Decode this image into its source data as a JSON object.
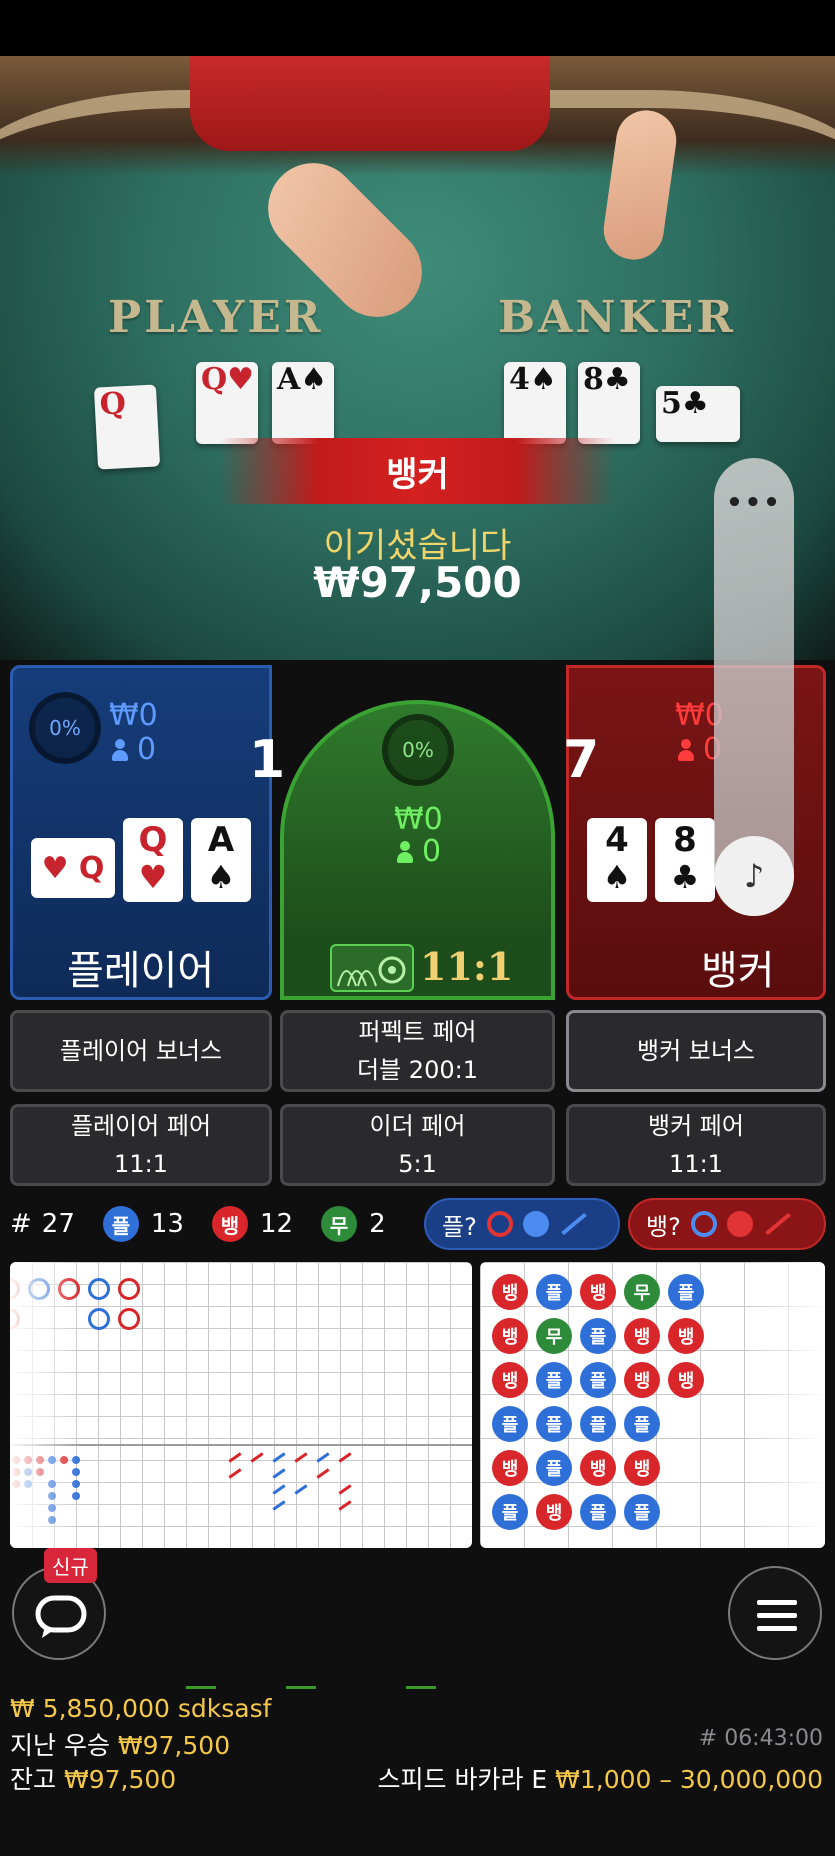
{
  "table": {
    "player_label": "PLAYER",
    "banker_label": "BANKER",
    "player_cards": [
      {
        "text": "Q",
        "color": "red"
      },
      {
        "text": "Q♥",
        "color": "red"
      },
      {
        "text": "A♠",
        "color": "black"
      }
    ],
    "banker_cards": [
      {
        "text": "4♠",
        "color": "black"
      },
      {
        "text": "8♣",
        "color": "black"
      },
      {
        "text": "5♣",
        "color": "black"
      }
    ]
  },
  "result": {
    "winner": "뱅커",
    "message": "이기셨습니다",
    "amount": "₩97,500"
  },
  "player_spot": {
    "percent": "0%",
    "bet_amount": "₩0",
    "bettors": "0",
    "score": "1",
    "name": "플레이어",
    "cards": [
      {
        "rank": "Q",
        "suit": "♥",
        "color": "red"
      },
      {
        "rank": "A",
        "suit": "♠",
        "color": "black"
      }
    ]
  },
  "tie_spot": {
    "percent": "0%",
    "bet_amount": "₩0",
    "bettors": "0",
    "payout": "11:1"
  },
  "banker_spot": {
    "bet_amount": "₩0",
    "bettors": "0",
    "score": "7",
    "name": "뱅커",
    "cards": [
      {
        "rank": "4",
        "suit": "♠",
        "color": "black"
      },
      {
        "rank": "8",
        "suit": "♣",
        "color": "black"
      }
    ]
  },
  "side_bets": {
    "player_bonus": "플레이어 보너스",
    "perfect_pair": "퍼펙트 페어",
    "perfect_pair_payout": "더블 200:1",
    "banker_bonus": "뱅커 보너스",
    "player_pair": "플레이어 페어",
    "player_pair_payout": "11:1",
    "either_pair": "이더 페어",
    "either_pair_payout": "5:1",
    "banker_pair": "뱅커 페어",
    "banker_pair_payout": "11:1"
  },
  "stats": {
    "round_prefix": "#",
    "round_count": "27",
    "player_badge": "플",
    "player_count": "13",
    "banker_badge": "뱅",
    "banker_count": "12",
    "tie_badge": "무",
    "tie_count": "2",
    "player_predict": "플?",
    "banker_predict": "뱅?"
  },
  "bead_road": [
    [
      "뱅",
      "뱅",
      "뱅",
      "플",
      "뱅",
      "플"
    ],
    [
      "플",
      "무",
      "플",
      "플",
      "플",
      "뱅"
    ],
    [
      "뱅",
      "플",
      "플",
      "플",
      "뱅",
      "플"
    ],
    [
      "무",
      "뱅",
      "뱅",
      "플",
      "뱅",
      "플"
    ],
    [
      "플",
      "뱅",
      "뱅",
      "",
      "",
      ""
    ]
  ],
  "colors": {
    "player": "#2f6fd8",
    "banker": "#d8262a",
    "tie": "#2e8b3a",
    "gold": "#f5c84a"
  },
  "bottom": {
    "new_badge": "신규",
    "jackpot_line": "₩ 5,850,000 sdksasf",
    "last_win_label": "지난 우승",
    "last_win_amount": "₩97,500",
    "balance_label": "잔고",
    "balance_amount": "₩97,500",
    "round_id": "# 06:43:00",
    "table_name": "스피드 바카라 E",
    "limits": "₩1,000 – 30,000,000"
  },
  "side_panel": {
    "more_icon": "more-icon",
    "music_icon": "music-note-icon"
  }
}
